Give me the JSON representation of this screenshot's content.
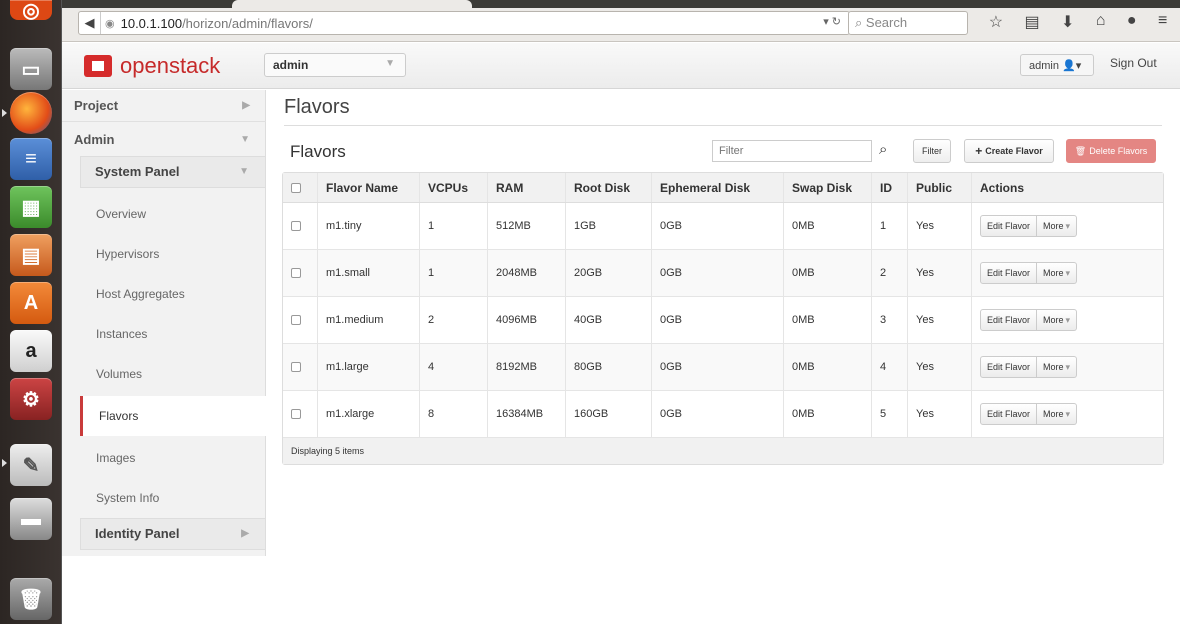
{
  "browser": {
    "url_host": "10.0.1.100",
    "url_path": "/horizon/admin/flavors/",
    "search_placeholder": "Search"
  },
  "header": {
    "brand": "openstack",
    "project": "admin",
    "user": "admin",
    "sign_out": "Sign Out"
  },
  "sidebar": {
    "project": "Project",
    "admin": "Admin",
    "system_panel": "System Panel",
    "items": [
      "Overview",
      "Hypervisors",
      "Host Aggregates",
      "Instances",
      "Volumes",
      "Flavors",
      "Images",
      "System Info"
    ],
    "identity_panel": "Identity Panel"
  },
  "main": {
    "page_title": "Flavors",
    "table_title": "Flavors",
    "filter_placeholder": "Filter",
    "filter_button": "Filter",
    "create_button": "Create Flavor",
    "delete_button": "Delete Flavors",
    "columns": [
      "Flavor Name",
      "VCPUs",
      "RAM",
      "Root Disk",
      "Ephemeral Disk",
      "Swap Disk",
      "ID",
      "Public",
      "Actions"
    ],
    "rows": [
      [
        "m1.tiny",
        "1",
        "512MB",
        "1GB",
        "0GB",
        "0MB",
        "1",
        "Yes"
      ],
      [
        "m1.small",
        "1",
        "2048MB",
        "20GB",
        "0GB",
        "0MB",
        "2",
        "Yes"
      ],
      [
        "m1.medium",
        "2",
        "4096MB",
        "40GB",
        "0GB",
        "0MB",
        "3",
        "Yes"
      ],
      [
        "m1.large",
        "4",
        "8192MB",
        "80GB",
        "0GB",
        "0MB",
        "4",
        "Yes"
      ],
      [
        "m1.xlarge",
        "8",
        "16384MB",
        "160GB",
        "0GB",
        "0MB",
        "5",
        "Yes"
      ]
    ],
    "edit_label": "Edit Flavor",
    "more_label": "More",
    "footer": "Displaying 5 items"
  }
}
